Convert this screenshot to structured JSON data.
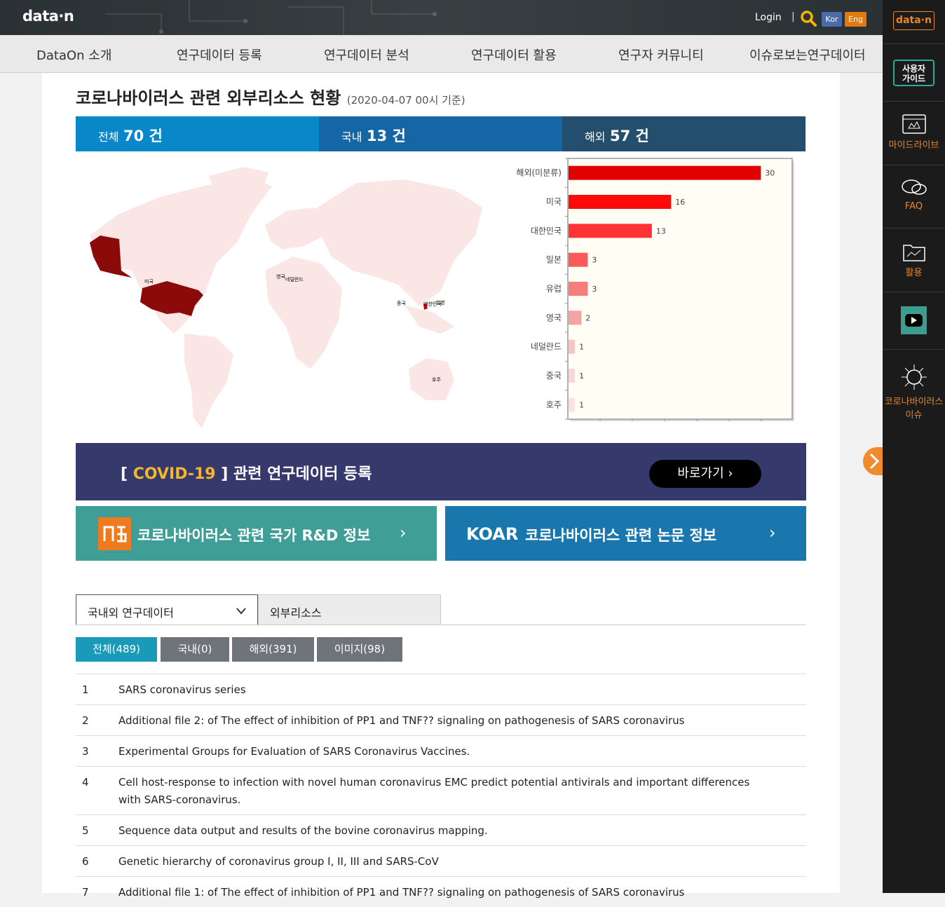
{
  "header": {
    "logo": "data·n",
    "login": "Login",
    "separator": "|",
    "lang_kor": "Kor",
    "lang_eng": "Eng"
  },
  "nav": {
    "items": [
      "DataOn 소개",
      "연구데이터 등록",
      "연구데이터 분석",
      "연구데이터 활용",
      "연구자 커뮤니티",
      "이슈로보는연구데이터"
    ]
  },
  "title": {
    "main": "코로나바이러스 관련 외부리소스 현황",
    "sub": "(2020-04-07 00시 기준)"
  },
  "stats": {
    "total_label": "전체",
    "total_value": "70 건",
    "domestic_label": "국내",
    "domestic_value": "13 건",
    "overseas_label": "해외",
    "overseas_value": "57 건"
  },
  "map_labels": [
    "미국",
    "영국",
    "네덜란드",
    "중국",
    "대한민국",
    "일본",
    "호주"
  ],
  "chart_data": {
    "type": "bar",
    "orientation": "horizontal",
    "categories": [
      "해외(미분류)",
      "미국",
      "대한민국",
      "일본",
      "유럽",
      "영국",
      "네덜란드",
      "중국",
      "호주"
    ],
    "values": [
      30,
      16,
      13,
      3,
      3,
      2,
      1,
      1,
      1
    ],
    "colors": [
      "#e30000",
      "#ff0a0a",
      "#ff3333",
      "#fb5a5a",
      "#f77c7c",
      "#f5a3a3",
      "#f6c6c6",
      "#f7d6d6",
      "#fae3e3"
    ],
    "xlim": [
      0,
      35
    ],
    "grid": false,
    "background": "#fffdf4"
  },
  "covid_banner": {
    "bracket_open": "[",
    "highlight": "COVID-19",
    "bracket_close": "]",
    "text": "관련 연구데이터 등록",
    "button": "바로가기"
  },
  "banners": {
    "ntis": "코로나바이러스 관련 국가 R&D 정보",
    "koar_logo": "KOAR",
    "koar": "코로나바이러스 관련 논문 정보",
    "arrow": "›"
  },
  "select_tabs": {
    "dropdown_value": "국내외 연구데이터",
    "second": "외부리소스"
  },
  "filters": [
    "전체(489)",
    "국내(0)",
    "해외(391)",
    "이미지(98)"
  ],
  "results": [
    {
      "no": "1",
      "title": "SARS coronavirus series"
    },
    {
      "no": "2",
      "title": "Additional file 2: of The effect of inhibition of PP1 and TNF?? signaling on pathogenesis of SARS coronavirus"
    },
    {
      "no": "3",
      "title": "Experimental Groups for Evaluation of SARS Coronavirus Vaccines."
    },
    {
      "no": "4",
      "title": "Cell host-response to infection with novel human coronavirus EMC predict potential antivirals and important differences with SARS-coronavirus."
    },
    {
      "no": "5",
      "title": "Sequence data output and results of the bovine coronavirus mapping."
    },
    {
      "no": "6",
      "title": "Genetic hierarchy of coronavirus group I, II, III and SARS-CoV"
    },
    {
      "no": "7",
      "title": "Additional file 1: of The effect of inhibition of PP1 and TNF?? signaling on pathogenesis of SARS coronavirus"
    }
  ],
  "sidebar": {
    "logo": "data·n",
    "guide": [
      "사용자",
      "가이드"
    ],
    "mylibrary": "마이드라이브",
    "faq": "FAQ",
    "usage": "활용",
    "corona": [
      "코로나바이러스",
      "이슈"
    ]
  },
  "colors": {
    "total": "#0887c9",
    "domestic": "#1467a4",
    "overseas": "#234e6d",
    "covid_bg": "#35396b",
    "accent_orange": "#e8872a"
  }
}
